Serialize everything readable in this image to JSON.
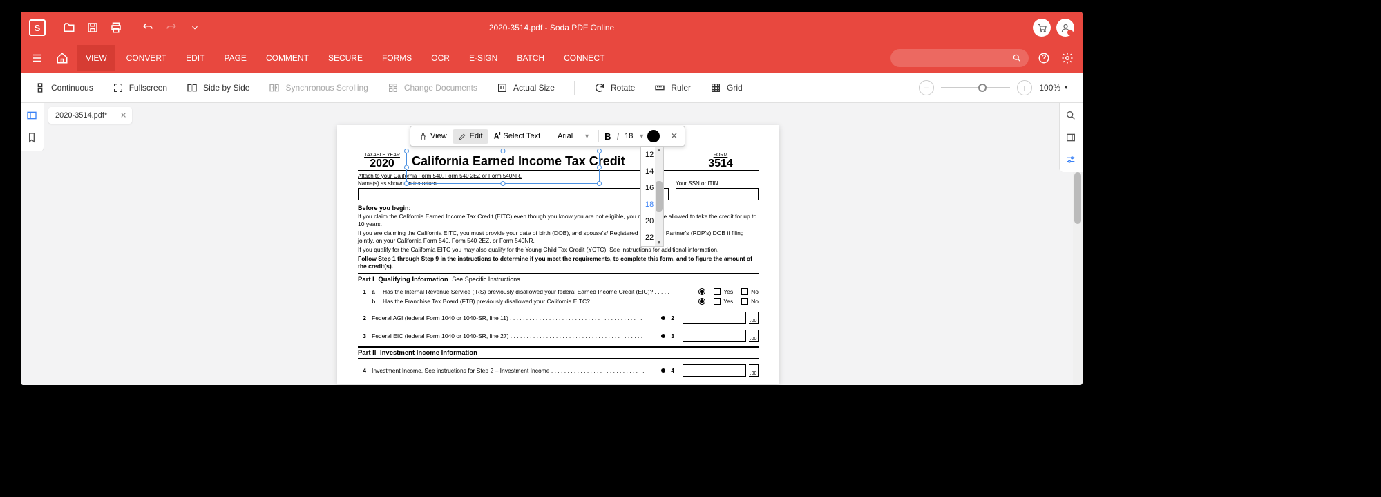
{
  "titlebar": {
    "title": "2020-3514.pdf - Soda PDF Online"
  },
  "menubar": {
    "items": [
      "VIEW",
      "CONVERT",
      "EDIT",
      "PAGE",
      "COMMENT",
      "SECURE",
      "FORMS",
      "OCR",
      "E-SIGN",
      "BATCH",
      "CONNECT"
    ],
    "active_index": 0
  },
  "toolbar": {
    "continuous": "Continuous",
    "fullscreen": "Fullscreen",
    "sidebyside": "Side by Side",
    "sync_scroll": "Synchronous Scrolling",
    "change_docs": "Change Documents",
    "actual_size": "Actual Size",
    "rotate": "Rotate",
    "ruler": "Ruler",
    "grid": "Grid",
    "zoom_value": "100%"
  },
  "tab": {
    "label": "2020-3514.pdf*"
  },
  "editbar": {
    "view": "View",
    "edit": "Edit",
    "select_text": "Select Text",
    "font": "Arial",
    "size": "18"
  },
  "size_dropdown": [
    "12",
    "14",
    "16",
    "18",
    "20",
    "22"
  ],
  "size_selected": "18",
  "doc": {
    "taxable_year_label": "TAXABLE YEAR",
    "year": "2020",
    "title": "California Earned Income Tax Credit",
    "form_label": "FORM",
    "form_num": "3514",
    "attach": "Attach to your California Form 540, Form 540 2EZ or Form 540NR.",
    "name_label": "Name(s) as shown on tax return",
    "ssn_label": "Your SSN or ITIN",
    "before_begin": "Before you begin:",
    "p1": "If you claim the California Earned Income Tax Credit (EITC) even though you know you are not eligible, you may not be allowed to take the credit for up to 10 years.",
    "p2": "If you are claiming the California EITC, you must provide your date of birth (DOB), and spouse's/ Registered Domestic Partner's (RDP's) DOB if filing jointly, on your California Form 540, Form 540 2EZ, or Form 540NR.",
    "p3": "If you qualify for the California EITC you may also qualify for the Young Child Tax Credit (YCTC). See instructions for additional information.",
    "p4": "Follow Step 1 through Step 9 in the instructions to determine if you meet the requirements, to complete this form, and to figure the amount of the credit(s).",
    "part1_label": "Part I",
    "part1_title": "Qualifying Information",
    "part1_note": "See Specific Instructions.",
    "q1a": "Has the Internal Revenue Service (IRS) previously disallowed your federal Earned Income Credit (EIC)?",
    "q1b": "Has the Franchise Tax Board (FTB) previously disallowed your California EITC?",
    "q2": "Federal AGI (federal Form 1040 or 1040-SR, line 11)",
    "q3": "Federal EIC (federal Form 1040 or 1040-SR, line 27)",
    "part2_label": "Part II",
    "part2_title": "Investment Income Information",
    "q4": "Investment Income. See instructions for Step 2 – Investment Income",
    "yes": "Yes",
    "no": "No",
    "cents": ".00"
  }
}
